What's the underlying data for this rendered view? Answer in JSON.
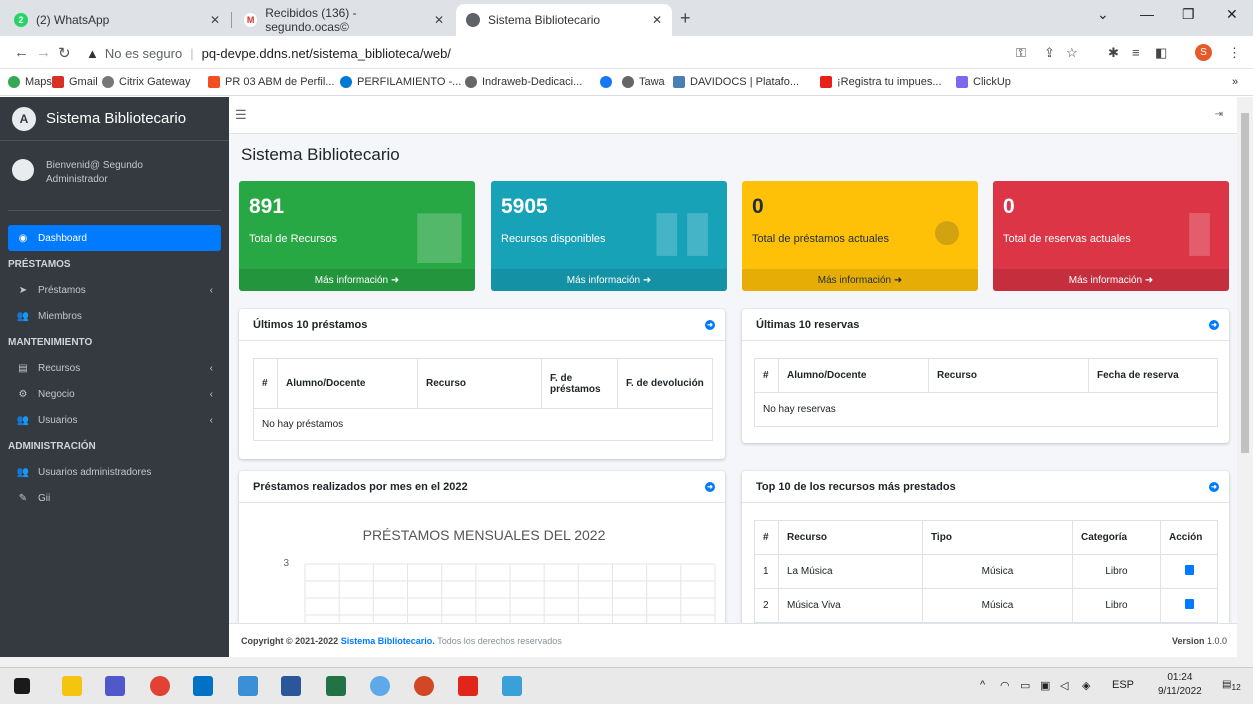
{
  "browser": {
    "tabs": [
      {
        "title": "(2) WhatsApp",
        "color": "#25d366"
      },
      {
        "title": "Recibidos (136) - segundo.ocas©",
        "color": "#d93025"
      },
      {
        "title": "Sistema Bibliotecario",
        "color": "#5f6368"
      }
    ],
    "security_label": "No es seguro",
    "url": "pq-devpe.ddns.net/sistema_biblioteca/web/",
    "profile_initial": "S",
    "bookmarks": [
      "Maps",
      "Gmail",
      "Citrix Gateway",
      "PR 03 ABM de Perfil...",
      "PERFILAMIENTO -...",
      "Indraweb-Dedicaci...",
      "Tawa",
      "DAVIDOCS | Platafo...",
      "¡Registra tu impues...",
      "ClickUp"
    ]
  },
  "sidebar": {
    "brand": "Sistema Bibliotecario",
    "user_greeting": "Bienvenid@ Segundo",
    "user_role": "Administrador",
    "items": [
      {
        "type": "item",
        "label": "Dashboard",
        "active": true,
        "icon": "dashboard-icon"
      },
      {
        "type": "header",
        "label": "PRÉSTAMOS"
      },
      {
        "type": "item",
        "label": "Préstamos",
        "icon": "paper-plane-icon",
        "chevron": true
      },
      {
        "type": "item",
        "label": "Miembros",
        "icon": "users-icon"
      },
      {
        "type": "header",
        "label": "MANTENIMIENTO"
      },
      {
        "type": "item",
        "label": "Recursos",
        "icon": "book-icon",
        "chevron": true
      },
      {
        "type": "item",
        "label": "Negocio",
        "icon": "gear-icon",
        "chevron": true
      },
      {
        "type": "item",
        "label": "Usuarios",
        "icon": "users-cog-icon",
        "chevron": true
      },
      {
        "type": "header",
        "label": "ADMINISTRACIÓN"
      },
      {
        "type": "item",
        "label": "Usuarios administradores",
        "icon": "users-icon"
      },
      {
        "type": "item",
        "label": "Gii",
        "icon": "edit-icon"
      }
    ]
  },
  "page": {
    "title": "Sistema Bibliotecario"
  },
  "stats": [
    {
      "value": "891",
      "label": "Total de Recursos",
      "more": "Más información"
    },
    {
      "value": "5905",
      "label": "Recursos disponibles",
      "more": "Más información"
    },
    {
      "value": "0",
      "label": "Total de préstamos actuales",
      "more": "Más información"
    },
    {
      "value": "0",
      "label": "Total de reservas actuales",
      "more": "Más información"
    }
  ],
  "loans": {
    "title": "Últimos 10 préstamos",
    "headers": [
      "#",
      "Alumno/Docente",
      "Recurso",
      "F. de préstamos",
      "F. de devolución"
    ],
    "empty": "No hay préstamos"
  },
  "reservations": {
    "title": "Últimas 10 reservas",
    "headers": [
      "#",
      "Alumno/Docente",
      "Recurso",
      "Fecha de reserva"
    ],
    "empty": "No hay reservas"
  },
  "monthly": {
    "title": "Préstamos realizados por mes en el 2022"
  },
  "top": {
    "title": "Top 10 de los recursos más prestados",
    "headers": [
      "#",
      "Recurso",
      "Tipo",
      "Categoría",
      "Acción"
    ],
    "rows": [
      {
        "n": "1",
        "recurso": "La Música",
        "tipo": "Música",
        "categoria": "Libro"
      },
      {
        "n": "2",
        "recurso": "Música Viva",
        "tipo": "Música",
        "categoria": "Libro"
      }
    ]
  },
  "chart_data": {
    "type": "line",
    "title": "PRÉSTAMOS MENSUALES DEL 2022",
    "y_ticks": [
      "3"
    ],
    "ylim": [
      0,
      3
    ],
    "grid": true
  },
  "footer": {
    "prefix": "Copyright © 2021-2022",
    "brand": "Sistema Bibliotecario.",
    "suffix": "Todos los derechos reservados",
    "version_label": "Version",
    "version": "1.0.0"
  },
  "taskbar": {
    "time": "01:24",
    "date": "9/11/2022",
    "lang": "ESP",
    "notif_count": "12"
  },
  "colors": {
    "green": "#28a745",
    "info": "#17a2b8",
    "warning": "#ffc107",
    "danger": "#dc3545",
    "primary": "#007bff",
    "sidebar": "#343a40"
  }
}
